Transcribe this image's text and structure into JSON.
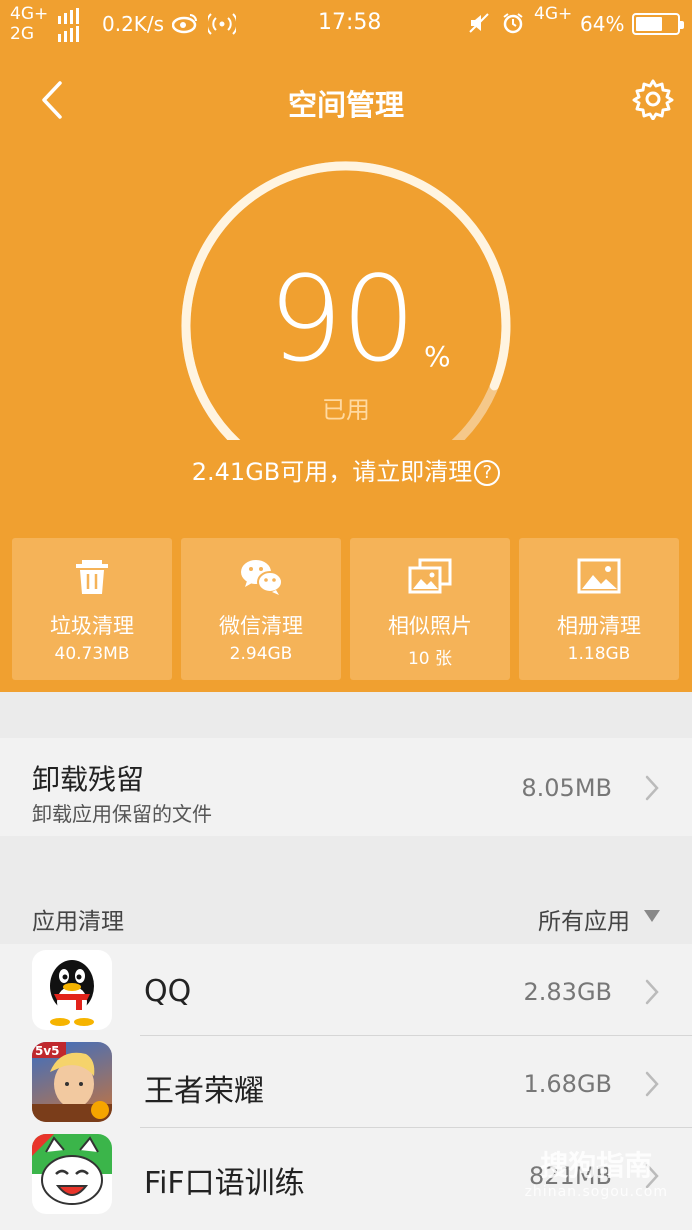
{
  "status_bar": {
    "network_top": "4G+",
    "network_bottom": "2G",
    "speed": "0.2K/s",
    "time": "17:58",
    "network_right": "4G+",
    "battery_pct": "64%",
    "battery_level": 0.64
  },
  "header": {
    "title": "空间管理",
    "back_icon": "back-chevron-icon",
    "settings_icon": "gear-icon"
  },
  "storage": {
    "used_percent": "90",
    "percent_sign": "%",
    "used_label": "已用",
    "available_text": "2.41GB可用，请立即清理",
    "help_symbol": "?"
  },
  "tiles": [
    {
      "label": "垃圾清理",
      "value": "40.73MB",
      "icon": "trash-icon"
    },
    {
      "label": "微信清理",
      "value": "2.94GB",
      "icon": "wechat-icon"
    },
    {
      "label": "相似照片",
      "value": "10 张",
      "icon": "similar-photos-icon"
    },
    {
      "label": "相册清理",
      "value": "1.18GB",
      "icon": "album-icon"
    }
  ],
  "residue": {
    "title": "卸载残留",
    "subtitle": "卸载应用保留的文件",
    "size": "8.05MB"
  },
  "apps": {
    "title": "应用清理",
    "filter": "所有应用",
    "items": [
      {
        "name": "QQ",
        "size": "2.83GB",
        "icon": "qq-icon"
      },
      {
        "name": "王者荣耀",
        "size": "1.68GB",
        "icon": "honor-of-kings-icon"
      },
      {
        "name": "FiF口语训练",
        "size": "821MB",
        "icon": "fif-icon"
      }
    ]
  },
  "watermark": {
    "main": "搜狗指南",
    "sub": "zhinan.sogou.com"
  },
  "colors": {
    "accent": "#f0a030",
    "tile": "#f5b358",
    "background": "#ebebeb"
  }
}
